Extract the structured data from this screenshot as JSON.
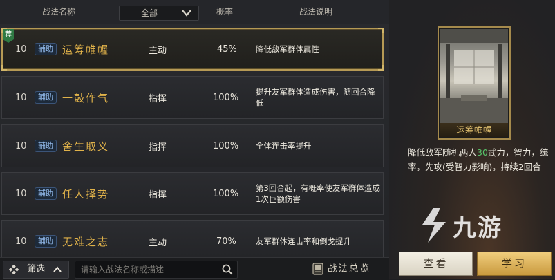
{
  "table": {
    "headers": {
      "name": "战法名称",
      "filter": "全部",
      "rate": "概率",
      "desc": "战法说明"
    },
    "rows": [
      {
        "level": "10",
        "badge": "辅助",
        "name": "运筹帷幄",
        "type": "主动",
        "rate": "45%",
        "desc": "降低敌军群体属性",
        "recommend": "荐",
        "selected": true
      },
      {
        "level": "10",
        "badge": "辅助",
        "name": "一鼓作气",
        "type": "指挥",
        "rate": "100%",
        "desc": "提升友军群体造成伤害，随回合降低"
      },
      {
        "level": "10",
        "badge": "辅助",
        "name": "舍生取义",
        "type": "指挥",
        "rate": "100%",
        "desc": "全体连击率提升"
      },
      {
        "level": "10",
        "badge": "辅助",
        "name": "任人择势",
        "type": "指挥",
        "rate": "100%",
        "desc": "第3回合起，有概率使友军群体造成1次巨额伤害"
      },
      {
        "level": "10",
        "badge": "辅助",
        "name": "无难之志",
        "type": "主动",
        "rate": "70%",
        "desc": "友军群体连击率和倒戈提升"
      }
    ]
  },
  "bottom": {
    "filter_label": "筛选",
    "search_placeholder": "请输入战法名称或描述",
    "overview_label": "战法总览"
  },
  "detail": {
    "card_title": "运筹帷幄",
    "desc_before": "降低敌军随机两人",
    "desc_highlight": "30",
    "desc_after": "武力，智力，统率，先攻(受智力影响)，持续2回合"
  },
  "actions": {
    "view_label": "查看",
    "learn_label": "学习"
  },
  "watermark": {
    "text": "九游"
  },
  "colors": {
    "accent_gold": "#e0b24a",
    "highlight_green": "#58c46a",
    "badge_blue": "#8fb6e6",
    "recommend_green": "#2f7a44"
  }
}
